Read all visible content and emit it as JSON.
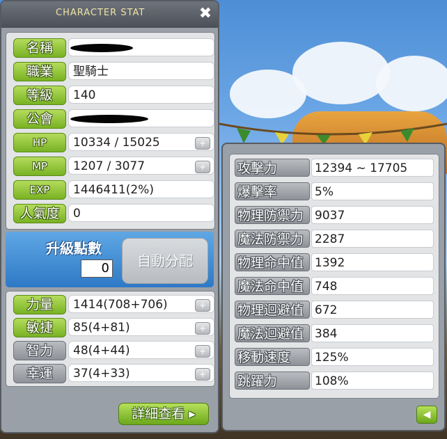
{
  "window": {
    "title": "CHARACTER STAT",
    "close_glyph": "✖"
  },
  "profile": [
    {
      "label": "名稱",
      "value": "",
      "redacted": true
    },
    {
      "label": "職業",
      "value": "聖騎士"
    },
    {
      "label": "等級",
      "value": "140"
    },
    {
      "label": "公會",
      "value": "",
      "redacted": true
    },
    {
      "label": "HP",
      "value": "10334 / 15025"
    },
    {
      "label": "MP",
      "value": "1207 / 3077"
    },
    {
      "label": "EXP",
      "value": "1446411(2%)"
    },
    {
      "label": "人氣度",
      "value": "0"
    }
  ],
  "ap": {
    "label": "升級點數",
    "value": "0",
    "auto_button": "自動分配"
  },
  "stats": [
    {
      "label": "力量",
      "value": "1414(708+706)"
    },
    {
      "label": "敏捷",
      "value": "85(4+81)"
    },
    {
      "label": "智力",
      "value": "48(4+44)"
    },
    {
      "label": "幸運",
      "value": "37(4+33)"
    }
  ],
  "detail_button": "詳細查看",
  "detail_stats": [
    {
      "label": "攻擊力",
      "value": "12394 ~ 17705"
    },
    {
      "label": "爆擊率",
      "value": "5%"
    },
    {
      "label": "物理防禦力",
      "value": "9037"
    },
    {
      "label": "魔法防禦力",
      "value": "2287"
    },
    {
      "label": "物理命中值",
      "value": "1392"
    },
    {
      "label": "魔法命中值",
      "value": "748"
    },
    {
      "label": "物理迴避值",
      "value": "672"
    },
    {
      "label": "魔法迴避值",
      "value": "384"
    },
    {
      "label": "移動速度",
      "value": "125%"
    },
    {
      "label": "跳躍力",
      "value": "108%"
    }
  ],
  "icons": {
    "plus": "plus-icon",
    "back": "back-arrow-icon",
    "close": "close-icon"
  }
}
